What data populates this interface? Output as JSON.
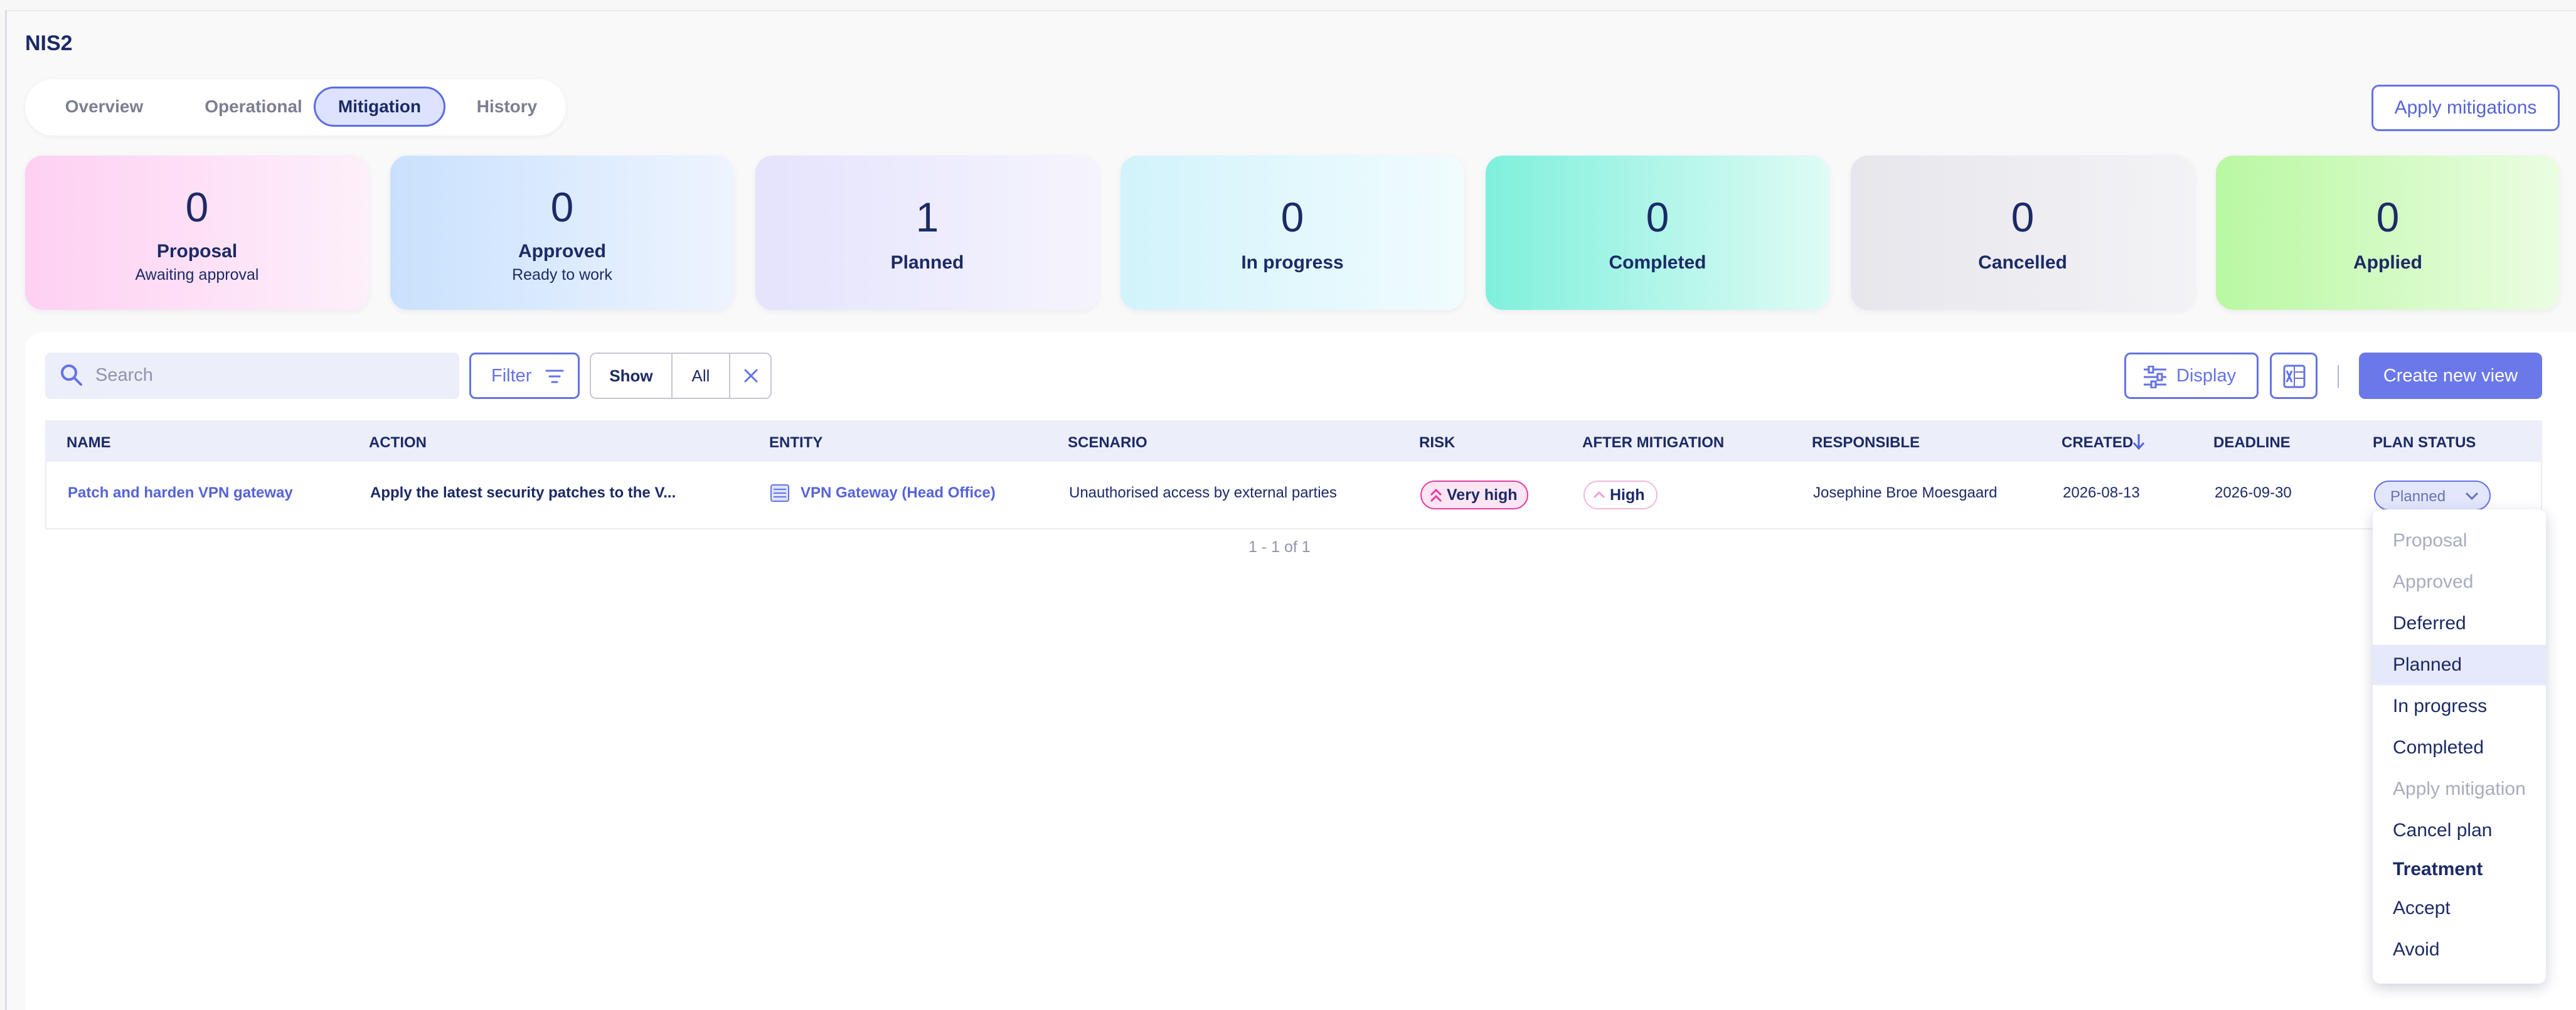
{
  "app": {
    "title": "NIS2"
  },
  "tabs": [
    {
      "label": "Overview"
    },
    {
      "label": "Operational"
    },
    {
      "label": "Mitigation"
    },
    {
      "label": "History"
    }
  ],
  "header": {
    "apply_label": "Apply mitigations"
  },
  "cards": [
    {
      "count": "0",
      "label": "Proposal",
      "sub": "Awaiting approval"
    },
    {
      "count": "0",
      "label": "Approved",
      "sub": "Ready to work"
    },
    {
      "count": "1",
      "label": "Planned"
    },
    {
      "count": "0",
      "label": "In progress"
    },
    {
      "count": "0",
      "label": "Completed"
    },
    {
      "count": "0",
      "label": "Cancelled"
    },
    {
      "count": "0",
      "label": "Applied"
    }
  ],
  "toolbar": {
    "search_placeholder": "Search",
    "filter_label": "Filter",
    "show_label": "Show",
    "show_value": "All",
    "display_label": "Display",
    "create_label": "Create new view"
  },
  "table": {
    "columns": [
      "NAME",
      "ACTION",
      "ENTITY",
      "SCENARIO",
      "RISK",
      "AFTER MITIGATION",
      "RESPONSIBLE",
      "CREATED",
      "DEADLINE",
      "PLAN STATUS"
    ],
    "rows": [
      {
        "name": "Patch and harden VPN gateway",
        "action": "Apply the latest security patches to the V...",
        "entity": "VPN Gateway (Head Office)",
        "scenario": "Unauthorised access by external parties",
        "risk": "Very high",
        "after": "High",
        "responsible": "Josephine Broe Moesgaard",
        "created": "2026-08-13",
        "deadline": "2026-09-30",
        "status": "Planned"
      }
    ],
    "pager": "1 - 1 of 1"
  },
  "status_menu": [
    {
      "label": "Proposal"
    },
    {
      "label": "Approved"
    },
    {
      "label": "Deferred"
    },
    {
      "label": "Planned"
    },
    {
      "label": "In progress"
    },
    {
      "label": "Completed"
    },
    {
      "label": "Apply mitigation"
    },
    {
      "label": "Cancel plan"
    },
    {
      "label": "Treatment"
    },
    {
      "label": "Accept"
    },
    {
      "label": "Avoid"
    }
  ],
  "colors": {
    "accent": "#6472e6",
    "risk_very_high": "#e43da1"
  }
}
